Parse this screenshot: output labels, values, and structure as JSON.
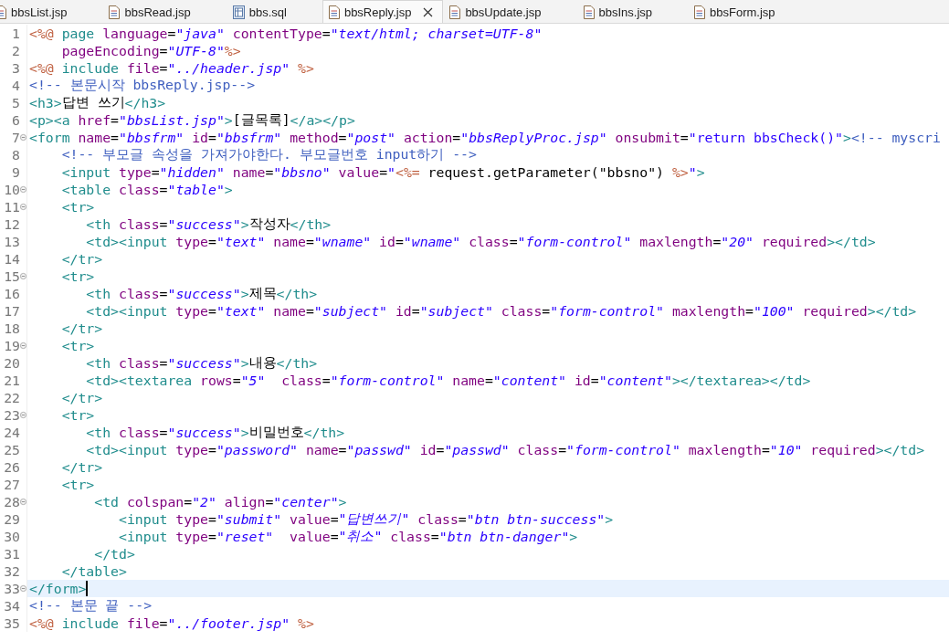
{
  "tabs": [
    {
      "label": "bbsList.jsp",
      "kind": "jsp",
      "selected": false,
      "closable": false
    },
    {
      "label": "bbsRead.jsp",
      "kind": "jsp",
      "selected": false,
      "closable": false
    },
    {
      "label": "bbs.sql",
      "kind": "sql",
      "selected": false,
      "closable": false
    },
    {
      "label": "bbsReply.jsp",
      "kind": "jsp",
      "selected": true,
      "closable": true
    },
    {
      "label": "bbsUpdate.jsp",
      "kind": "jsp",
      "selected": false,
      "closable": false
    },
    {
      "label": "bbsIns.jsp",
      "kind": "jsp",
      "selected": false,
      "closable": false
    },
    {
      "label": "bbsForm.jsp",
      "kind": "jsp",
      "selected": false,
      "closable": false
    }
  ],
  "lines": [
    {
      "number": "1",
      "foldable": false,
      "current": false,
      "tokens": [
        {
          "kind": "delim",
          "text": "<%@"
        },
        {
          "kind": "tag",
          "text": " page"
        },
        {
          "kind": "attr",
          "text": " language"
        },
        {
          "kind": "plain",
          "text": "="
        },
        {
          "kind": "value",
          "text": "\"java\""
        },
        {
          "kind": "attr",
          "text": " contentType"
        },
        {
          "kind": "plain",
          "text": "="
        },
        {
          "kind": "value",
          "text": "\"text/html; charset=UTF-8\""
        }
      ]
    },
    {
      "number": "2",
      "foldable": false,
      "current": false,
      "tokens": [
        {
          "kind": "attr",
          "text": "    pageEncoding"
        },
        {
          "kind": "plain",
          "text": "="
        },
        {
          "kind": "value",
          "text": "\"UTF-8\""
        },
        {
          "kind": "delim",
          "text": "%>"
        }
      ]
    },
    {
      "number": "3",
      "foldable": false,
      "current": false,
      "tokens": [
        {
          "kind": "delim",
          "text": "<%@"
        },
        {
          "kind": "tag",
          "text": " include"
        },
        {
          "kind": "attr",
          "text": " file"
        },
        {
          "kind": "plain",
          "text": "="
        },
        {
          "kind": "value",
          "text": "\"../header.jsp\""
        },
        {
          "kind": "delim",
          "text": " %>"
        }
      ]
    },
    {
      "number": "4",
      "foldable": false,
      "current": false,
      "tokens": [
        {
          "kind": "comment",
          "text": "<!-- 본문시작 bbsReply.jsp-->"
        }
      ]
    },
    {
      "number": "5",
      "foldable": false,
      "current": false,
      "tokens": [
        {
          "kind": "tag",
          "text": "<h3>"
        },
        {
          "kind": "plain",
          "text": "답변 쓰기"
        },
        {
          "kind": "tag",
          "text": "</h3>"
        }
      ]
    },
    {
      "number": "6",
      "foldable": false,
      "current": false,
      "tokens": [
        {
          "kind": "tag",
          "text": "<p><a"
        },
        {
          "kind": "attr",
          "text": " href"
        },
        {
          "kind": "plain",
          "text": "="
        },
        {
          "kind": "value",
          "text": "\"bbsList.jsp\""
        },
        {
          "kind": "tag",
          "text": ">"
        },
        {
          "kind": "plain",
          "text": "[글목록]"
        },
        {
          "kind": "tag",
          "text": "</a></p>"
        }
      ]
    },
    {
      "number": "7",
      "foldable": true,
      "current": false,
      "tokens": [
        {
          "kind": "tag",
          "text": "<form"
        },
        {
          "kind": "attr",
          "text": " name"
        },
        {
          "kind": "plain",
          "text": "="
        },
        {
          "kind": "value",
          "text": "\"bbsfrm\""
        },
        {
          "kind": "attr",
          "text": " id"
        },
        {
          "kind": "plain",
          "text": "="
        },
        {
          "kind": "value",
          "text": "\"bbsfrm\""
        },
        {
          "kind": "attr",
          "text": " method"
        },
        {
          "kind": "plain",
          "text": "="
        },
        {
          "kind": "value",
          "text": "\"post\""
        },
        {
          "kind": "attr",
          "text": " action"
        },
        {
          "kind": "plain",
          "text": "="
        },
        {
          "kind": "value",
          "text": "\"bbsReplyProc.jsp\""
        },
        {
          "kind": "attr",
          "text": " onsubmit"
        },
        {
          "kind": "plain",
          "text": "="
        },
        {
          "kind": "script",
          "text": "\"return bbsCheck()\""
        },
        {
          "kind": "tag",
          "text": ">"
        },
        {
          "kind": "comment",
          "text": "<!-- myscri"
        }
      ]
    },
    {
      "number": "8",
      "foldable": false,
      "current": false,
      "tokens": [
        {
          "kind": "comment",
          "text": "    <!-- 부모글 속성을 가져가야한다. 부모글번호 input하기 -->"
        }
      ]
    },
    {
      "number": "9",
      "foldable": false,
      "current": false,
      "tokens": [
        {
          "kind": "tag",
          "text": "    <input"
        },
        {
          "kind": "attr",
          "text": " type"
        },
        {
          "kind": "plain",
          "text": "="
        },
        {
          "kind": "value",
          "text": "\"hidden\""
        },
        {
          "kind": "attr",
          "text": " name"
        },
        {
          "kind": "plain",
          "text": "="
        },
        {
          "kind": "value",
          "text": "\"bbsno\""
        },
        {
          "kind": "attr",
          "text": " value"
        },
        {
          "kind": "plain",
          "text": "="
        },
        {
          "kind": "value",
          "text": "\""
        },
        {
          "kind": "delim",
          "text": "<%="
        },
        {
          "kind": "plain",
          "text": " request.getParameter(\"bbsno\") "
        },
        {
          "kind": "delim",
          "text": "%>"
        },
        {
          "kind": "script",
          "text": "\""
        },
        {
          "kind": "tag",
          "text": ">"
        }
      ]
    },
    {
      "number": "10",
      "foldable": true,
      "current": false,
      "tokens": [
        {
          "kind": "tag",
          "text": "    <table"
        },
        {
          "kind": "attr",
          "text": " class"
        },
        {
          "kind": "plain",
          "text": "="
        },
        {
          "kind": "value",
          "text": "\"table\""
        },
        {
          "kind": "tag",
          "text": ">"
        }
      ]
    },
    {
      "number": "11",
      "foldable": true,
      "current": false,
      "tokens": [
        {
          "kind": "tag",
          "text": "    <tr>"
        }
      ]
    },
    {
      "number": "12",
      "foldable": false,
      "current": false,
      "tokens": [
        {
          "kind": "tag",
          "text": "       <th"
        },
        {
          "kind": "attr",
          "text": " class"
        },
        {
          "kind": "plain",
          "text": "="
        },
        {
          "kind": "value",
          "text": "\"success\""
        },
        {
          "kind": "tag",
          "text": ">"
        },
        {
          "kind": "plain",
          "text": "작성자"
        },
        {
          "kind": "tag",
          "text": "</th>"
        }
      ]
    },
    {
      "number": "13",
      "foldable": false,
      "current": false,
      "tokens": [
        {
          "kind": "tag",
          "text": "       <td><input"
        },
        {
          "kind": "attr",
          "text": " type"
        },
        {
          "kind": "plain",
          "text": "="
        },
        {
          "kind": "value",
          "text": "\"text\""
        },
        {
          "kind": "attr",
          "text": " name"
        },
        {
          "kind": "plain",
          "text": "="
        },
        {
          "kind": "value",
          "text": "\"wname\""
        },
        {
          "kind": "attr",
          "text": " id"
        },
        {
          "kind": "plain",
          "text": "="
        },
        {
          "kind": "value",
          "text": "\"wname\""
        },
        {
          "kind": "attr",
          "text": " class"
        },
        {
          "kind": "plain",
          "text": "="
        },
        {
          "kind": "value",
          "text": "\"form-control\""
        },
        {
          "kind": "attr",
          "text": " maxlength"
        },
        {
          "kind": "plain",
          "text": "="
        },
        {
          "kind": "value",
          "text": "\"20\""
        },
        {
          "kind": "attr",
          "text": " required"
        },
        {
          "kind": "tag",
          "text": "></td>"
        }
      ]
    },
    {
      "number": "14",
      "foldable": false,
      "current": false,
      "tokens": [
        {
          "kind": "tag",
          "text": "    </tr>"
        }
      ]
    },
    {
      "number": "15",
      "foldable": true,
      "current": false,
      "tokens": [
        {
          "kind": "tag",
          "text": "    <tr>"
        }
      ]
    },
    {
      "number": "16",
      "foldable": false,
      "current": false,
      "tokens": [
        {
          "kind": "tag",
          "text": "       <th"
        },
        {
          "kind": "attr",
          "text": " class"
        },
        {
          "kind": "plain",
          "text": "="
        },
        {
          "kind": "value",
          "text": "\"success\""
        },
        {
          "kind": "tag",
          "text": ">"
        },
        {
          "kind": "plain",
          "text": "제목"
        },
        {
          "kind": "tag",
          "text": "</th>"
        }
      ]
    },
    {
      "number": "17",
      "foldable": false,
      "current": false,
      "tokens": [
        {
          "kind": "tag",
          "text": "       <td><input"
        },
        {
          "kind": "attr",
          "text": " type"
        },
        {
          "kind": "plain",
          "text": "="
        },
        {
          "kind": "value",
          "text": "\"text\""
        },
        {
          "kind": "attr",
          "text": " name"
        },
        {
          "kind": "plain",
          "text": "="
        },
        {
          "kind": "value",
          "text": "\"subject\""
        },
        {
          "kind": "attr",
          "text": " id"
        },
        {
          "kind": "plain",
          "text": "="
        },
        {
          "kind": "value",
          "text": "\"subject\""
        },
        {
          "kind": "attr",
          "text": " class"
        },
        {
          "kind": "plain",
          "text": "="
        },
        {
          "kind": "value",
          "text": "\"form-control\""
        },
        {
          "kind": "attr",
          "text": " maxlength"
        },
        {
          "kind": "plain",
          "text": "="
        },
        {
          "kind": "value",
          "text": "\"100\""
        },
        {
          "kind": "attr",
          "text": " required"
        },
        {
          "kind": "tag",
          "text": "></td>"
        }
      ]
    },
    {
      "number": "18",
      "foldable": false,
      "current": false,
      "tokens": [
        {
          "kind": "tag",
          "text": "    </tr>"
        }
      ]
    },
    {
      "number": "19",
      "foldable": true,
      "current": false,
      "tokens": [
        {
          "kind": "tag",
          "text": "    <tr>"
        }
      ]
    },
    {
      "number": "20",
      "foldable": false,
      "current": false,
      "tokens": [
        {
          "kind": "tag",
          "text": "       <th"
        },
        {
          "kind": "attr",
          "text": " class"
        },
        {
          "kind": "plain",
          "text": "="
        },
        {
          "kind": "value",
          "text": "\"success\""
        },
        {
          "kind": "tag",
          "text": ">"
        },
        {
          "kind": "plain",
          "text": "내용"
        },
        {
          "kind": "tag",
          "text": "</th>"
        }
      ]
    },
    {
      "number": "21",
      "foldable": false,
      "current": false,
      "tokens": [
        {
          "kind": "tag",
          "text": "       <td><textarea"
        },
        {
          "kind": "attr",
          "text": " rows"
        },
        {
          "kind": "plain",
          "text": "="
        },
        {
          "kind": "value",
          "text": "\"5\""
        },
        {
          "kind": "attr",
          "text": "  class"
        },
        {
          "kind": "plain",
          "text": "="
        },
        {
          "kind": "value",
          "text": "\"form-control\""
        },
        {
          "kind": "attr",
          "text": " name"
        },
        {
          "kind": "plain",
          "text": "="
        },
        {
          "kind": "value",
          "text": "\"content\""
        },
        {
          "kind": "attr",
          "text": " id"
        },
        {
          "kind": "plain",
          "text": "="
        },
        {
          "kind": "value",
          "text": "\"content\""
        },
        {
          "kind": "tag",
          "text": "></textarea></td>"
        }
      ]
    },
    {
      "number": "22",
      "foldable": false,
      "current": false,
      "tokens": [
        {
          "kind": "tag",
          "text": "    </tr>"
        }
      ]
    },
    {
      "number": "23",
      "foldable": true,
      "current": false,
      "tokens": [
        {
          "kind": "tag",
          "text": "    <tr>"
        }
      ]
    },
    {
      "number": "24",
      "foldable": false,
      "current": false,
      "tokens": [
        {
          "kind": "tag",
          "text": "       <th"
        },
        {
          "kind": "attr",
          "text": " class"
        },
        {
          "kind": "plain",
          "text": "="
        },
        {
          "kind": "value",
          "text": "\"success\""
        },
        {
          "kind": "tag",
          "text": ">"
        },
        {
          "kind": "plain",
          "text": "비밀번호"
        },
        {
          "kind": "tag",
          "text": "</th>"
        }
      ]
    },
    {
      "number": "25",
      "foldable": false,
      "current": false,
      "tokens": [
        {
          "kind": "tag",
          "text": "       <td><input"
        },
        {
          "kind": "attr",
          "text": " type"
        },
        {
          "kind": "plain",
          "text": "="
        },
        {
          "kind": "value",
          "text": "\"password\""
        },
        {
          "kind": "attr",
          "text": " name"
        },
        {
          "kind": "plain",
          "text": "="
        },
        {
          "kind": "value",
          "text": "\"passwd\""
        },
        {
          "kind": "attr",
          "text": " id"
        },
        {
          "kind": "plain",
          "text": "="
        },
        {
          "kind": "value",
          "text": "\"passwd\""
        },
        {
          "kind": "attr",
          "text": " class"
        },
        {
          "kind": "plain",
          "text": "="
        },
        {
          "kind": "value",
          "text": "\"form-control\""
        },
        {
          "kind": "attr",
          "text": " maxlength"
        },
        {
          "kind": "plain",
          "text": "="
        },
        {
          "kind": "value",
          "text": "\"10\""
        },
        {
          "kind": "attr",
          "text": " required"
        },
        {
          "kind": "tag",
          "text": "></td>"
        }
      ]
    },
    {
      "number": "26",
      "foldable": false,
      "current": false,
      "tokens": [
        {
          "kind": "tag",
          "text": "    </tr>"
        }
      ]
    },
    {
      "number": "27",
      "foldable": false,
      "current": false,
      "tokens": [
        {
          "kind": "tag",
          "text": "    <tr>"
        }
      ]
    },
    {
      "number": "28",
      "foldable": true,
      "current": false,
      "tokens": [
        {
          "kind": "tag",
          "text": "        <td"
        },
        {
          "kind": "attr",
          "text": " colspan"
        },
        {
          "kind": "plain",
          "text": "="
        },
        {
          "kind": "value",
          "text": "\"2\""
        },
        {
          "kind": "attr",
          "text": " align"
        },
        {
          "kind": "plain",
          "text": "="
        },
        {
          "kind": "value",
          "text": "\"center\""
        },
        {
          "kind": "tag",
          "text": ">"
        }
      ]
    },
    {
      "number": "29",
      "foldable": false,
      "current": false,
      "tokens": [
        {
          "kind": "tag",
          "text": "           <input"
        },
        {
          "kind": "attr",
          "text": " type"
        },
        {
          "kind": "plain",
          "text": "="
        },
        {
          "kind": "value",
          "text": "\"submit\""
        },
        {
          "kind": "attr",
          "text": " value"
        },
        {
          "kind": "plain",
          "text": "="
        },
        {
          "kind": "value",
          "text": "\"답변쓰기\""
        },
        {
          "kind": "attr",
          "text": " class"
        },
        {
          "kind": "plain",
          "text": "="
        },
        {
          "kind": "value",
          "text": "\"btn btn-success\""
        },
        {
          "kind": "tag",
          "text": ">"
        }
      ]
    },
    {
      "number": "30",
      "foldable": false,
      "current": false,
      "tokens": [
        {
          "kind": "tag",
          "text": "           <input"
        },
        {
          "kind": "attr",
          "text": " type"
        },
        {
          "kind": "plain",
          "text": "="
        },
        {
          "kind": "value",
          "text": "\"reset\""
        },
        {
          "kind": "attr",
          "text": "  value"
        },
        {
          "kind": "plain",
          "text": "="
        },
        {
          "kind": "value",
          "text": "\"취소\""
        },
        {
          "kind": "attr",
          "text": " class"
        },
        {
          "kind": "plain",
          "text": "="
        },
        {
          "kind": "value",
          "text": "\"btn btn-danger\""
        },
        {
          "kind": "tag",
          "text": ">"
        }
      ]
    },
    {
      "number": "31",
      "foldable": false,
      "current": false,
      "tokens": [
        {
          "kind": "tag",
          "text": "        </td>"
        }
      ]
    },
    {
      "number": "32",
      "foldable": false,
      "current": false,
      "tokens": [
        {
          "kind": "tag",
          "text": "    </table>"
        }
      ]
    },
    {
      "number": "33",
      "foldable": true,
      "current": true,
      "tokens": [
        {
          "kind": "tag",
          "text": "</form>"
        }
      ]
    },
    {
      "number": "34",
      "foldable": false,
      "current": false,
      "tokens": [
        {
          "kind": "comment",
          "text": "<!-- 본문 끝 -->"
        }
      ]
    },
    {
      "number": "35",
      "foldable": false,
      "current": false,
      "tokens": [
        {
          "kind": "delim",
          "text": "<%@"
        },
        {
          "kind": "tag",
          "text": " include"
        },
        {
          "kind": "attr",
          "text": " file"
        },
        {
          "kind": "plain",
          "text": "="
        },
        {
          "kind": "value",
          "text": "\"../footer.jsp\""
        },
        {
          "kind": "delim",
          "text": " %>"
        }
      ]
    }
  ]
}
